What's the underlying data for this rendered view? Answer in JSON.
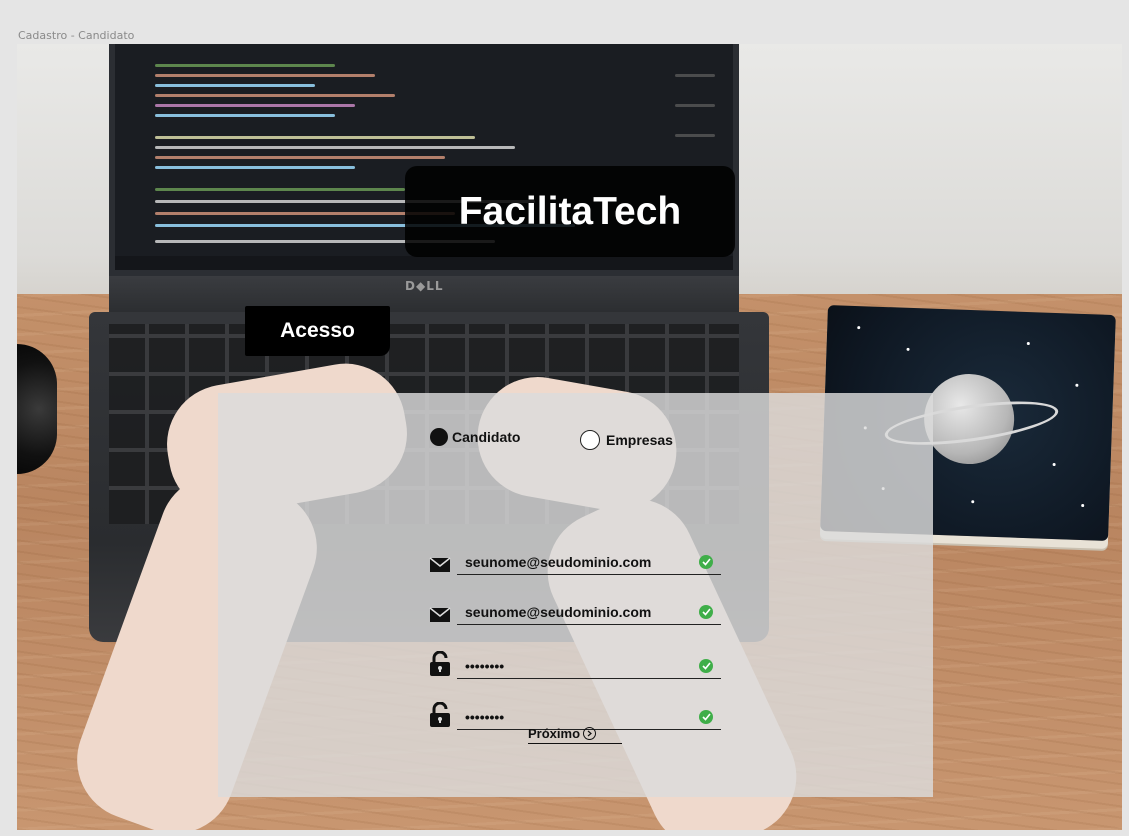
{
  "frame": {
    "label": "Cadastro  - Candidato"
  },
  "brand": {
    "title": "FacilitaTech"
  },
  "tab": {
    "label": "Acesso"
  },
  "form": {
    "account_type": {
      "options": [
        "Candidato",
        "Empresas"
      ],
      "selected": "Candidato"
    },
    "fields": [
      {
        "name": "email",
        "icon": "envelope-icon",
        "value": "seunome@seudominio.com",
        "valid": true
      },
      {
        "name": "confirm-email",
        "icon": "envelope-icon",
        "value": "seunome@seudominio.com",
        "valid": true
      },
      {
        "name": "password",
        "icon": "lock-icon",
        "value": "********",
        "valid": true
      },
      {
        "name": "confirm-password",
        "icon": "lock-icon",
        "value": "********",
        "valid": true
      }
    ],
    "next_label": "Próximo"
  },
  "colors": {
    "brand_bg": "#000000",
    "valid_check": "#3fae49",
    "panel_overlay": "#dcdcdc"
  }
}
